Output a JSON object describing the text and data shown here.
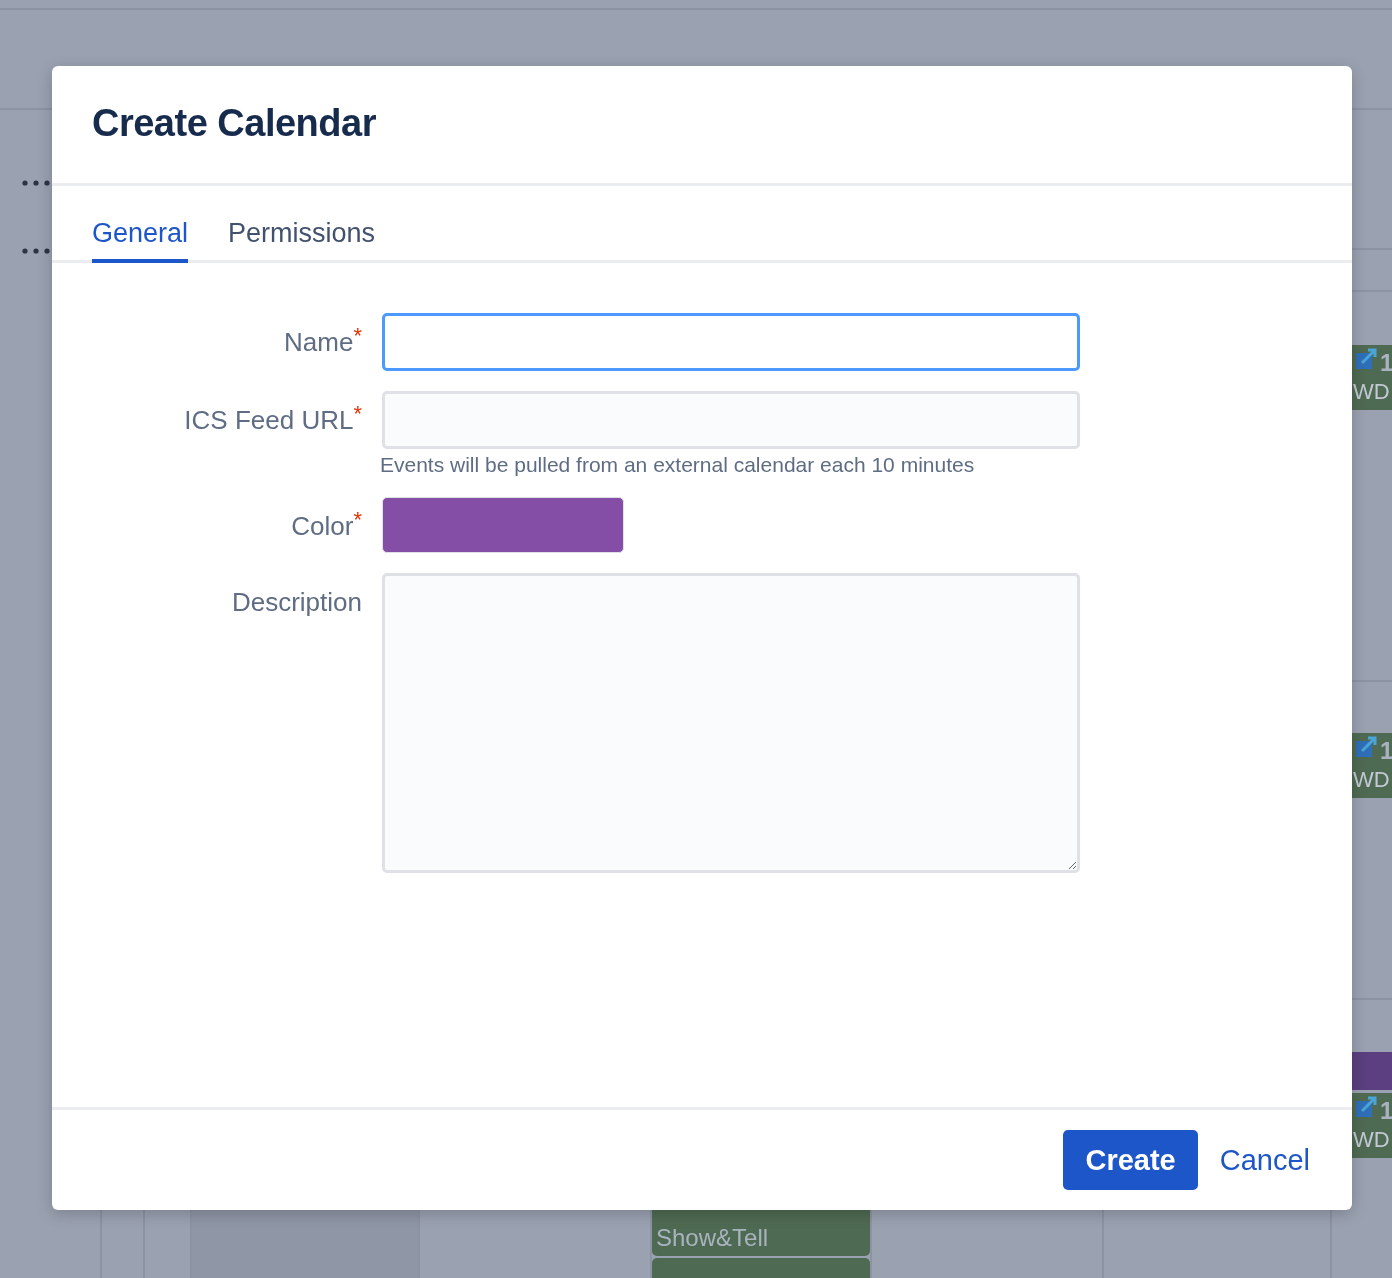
{
  "background": {
    "events": [
      {
        "kind": "side",
        "number": "1",
        "text": "WD"
      },
      {
        "kind": "side",
        "number": "1",
        "text": "WD"
      },
      {
        "kind": "side",
        "number": "1",
        "text": "WD"
      },
      {
        "kind": "block",
        "text": "Show&Tell"
      }
    ]
  },
  "dialog": {
    "title": "Create Calendar",
    "tabs": [
      {
        "label": "General",
        "selected": true
      },
      {
        "label": "Permissions",
        "selected": false
      }
    ],
    "fields": [
      {
        "kind": "text",
        "label": "Name",
        "required_mark": "*",
        "focused": true
      },
      {
        "kind": "text",
        "label": "ICS Feed URL",
        "required_mark": "*",
        "focused": false,
        "help": "Events will be pulled from an external calendar each 10 minutes"
      },
      {
        "kind": "color",
        "label": "Color",
        "required_mark": "*",
        "color": "#844ea6"
      },
      {
        "kind": "textarea",
        "label": "Description"
      }
    ],
    "buttons": [
      {
        "label": "Create",
        "kind": "primary"
      },
      {
        "label": "Cancel",
        "kind": "link"
      }
    ]
  }
}
